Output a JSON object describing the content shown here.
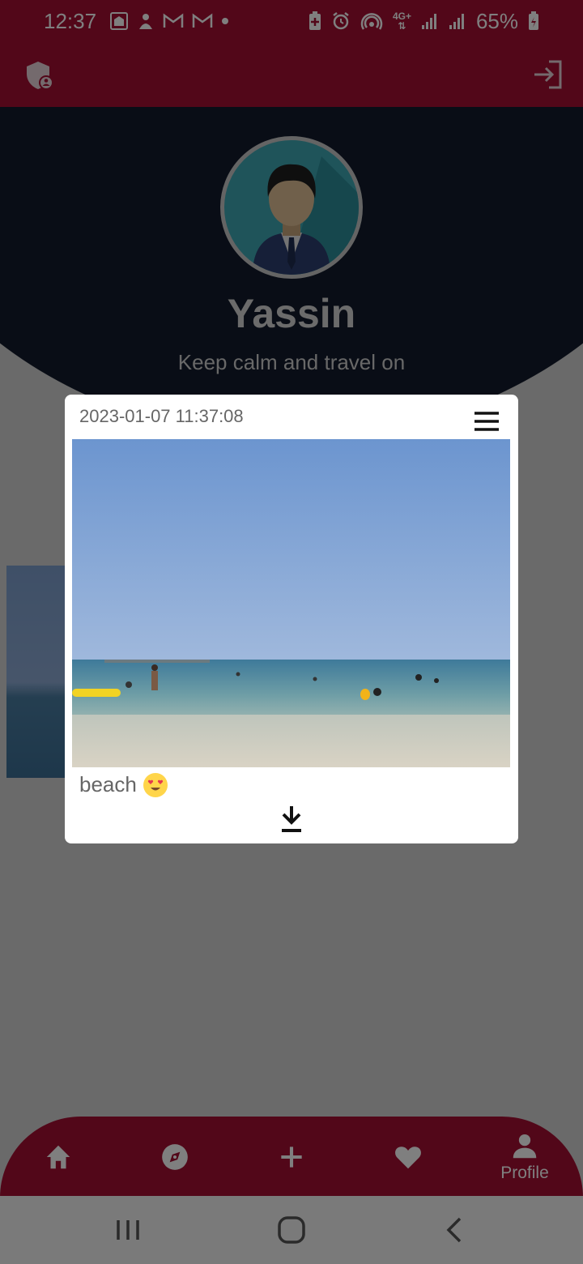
{
  "status_bar": {
    "time": "12:37",
    "battery": "65%",
    "network": "4G+",
    "left_icons": [
      "prayer-app-icon",
      "notification-icon",
      "gmail-icon",
      "gmail-icon",
      "dot-icon"
    ],
    "right_icons": [
      "battery-saver-icon",
      "alarm-icon",
      "hotspot-icon",
      "network-4g-icon",
      "signal-icon",
      "signal-icon",
      "battery-icon"
    ]
  },
  "app_bar": {
    "left_icon": "shield-user-icon",
    "right_icon": "logout-icon"
  },
  "profile": {
    "name": "Yassin",
    "bio": "Keep calm and travel on",
    "avatar_icon": "user-avatar-icon"
  },
  "dialog": {
    "timestamp": "2023-01-07 11:37:08",
    "caption": "beach",
    "caption_emoji": "heart-eyes-emoji",
    "menu_icon": "hamburger-menu-icon",
    "download_icon": "download-icon",
    "photo_subject": "beach"
  },
  "bottom_nav": {
    "items": [
      {
        "icon": "home-icon",
        "label": ""
      },
      {
        "icon": "compass-icon",
        "label": ""
      },
      {
        "icon": "plus-icon",
        "label": ""
      },
      {
        "icon": "heart-icon",
        "label": ""
      },
      {
        "icon": "person-icon",
        "label": "Profile"
      }
    ]
  },
  "system_nav": {
    "buttons": [
      "recents-icon",
      "home-circle-icon",
      "back-icon"
    ]
  },
  "colors": {
    "primary": "#a50f33",
    "header_dark": "#131b2c",
    "avatar_bg": "#3ea8b5",
    "dialog_bg": "#ffffff",
    "scrim": "rgba(0,0,0,0.5)"
  }
}
